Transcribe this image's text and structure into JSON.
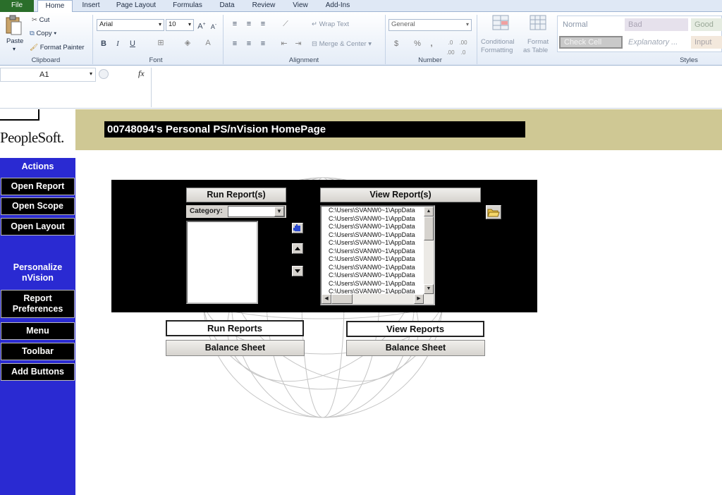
{
  "ribbon": {
    "tabs": [
      "File",
      "Home",
      "Insert",
      "Page Layout",
      "Formulas",
      "Data",
      "Review",
      "View",
      "Add-Ins"
    ],
    "clipboard": {
      "paste": "Paste",
      "cut": "Cut",
      "copy": "Copy",
      "format_painter": "Format Painter",
      "label": "Clipboard"
    },
    "font": {
      "name": "Arial",
      "size": "10",
      "bold": "B",
      "italic": "I",
      "underline": "U",
      "label": "Font"
    },
    "alignment": {
      "wrap_text": "Wrap Text",
      "merge_center": "Merge & Center",
      "label": "Alignment"
    },
    "number": {
      "format": "General",
      "currency": "$",
      "percent": "%",
      "comma": ",",
      "label": "Number"
    },
    "styles": {
      "conditional_formatting": [
        "Conditional",
        "Formatting"
      ],
      "format_as_table": [
        "Format",
        "as Table"
      ],
      "normal": "Normal",
      "bad": "Bad",
      "good": "Good",
      "check_cell": "Check Cell",
      "explanatory": "Explanatory ...",
      "input": "Input",
      "label": "Styles"
    }
  },
  "formula_bar": {
    "name_box": "A1",
    "fx": "fx",
    "formula": ""
  },
  "sheet": {
    "brand": "PeopleSoft.",
    "title": "00748094's Personal PS/nVision HomePage",
    "sidebar": {
      "actions_label": "Actions",
      "actions": [
        "Open Report",
        "Open Scope",
        "Open Layout"
      ],
      "personalize_label": [
        "Personalize",
        "nVision"
      ],
      "personalize": [
        [
          "Report",
          "Preferences"
        ],
        [
          "Menu"
        ],
        [
          "Toolbar"
        ],
        [
          "Add Buttons"
        ]
      ]
    },
    "panel": {
      "run_reports_btn": "Run Report(s)",
      "view_reports_btn": "View Report(s)",
      "category_label": "Category:",
      "category_value": "",
      "report_paths": [
        "C:\\Users\\SVANW0~1\\AppData",
        "C:\\Users\\SVANW0~1\\AppData",
        "C:\\Users\\SVANW0~1\\AppData",
        "C:\\Users\\SVANW0~1\\AppData",
        "C:\\Users\\SVANW0~1\\AppData",
        "C:\\Users\\SVANW0~1\\AppData",
        "C:\\Users\\SVANW0~1\\AppData",
        "C:\\Users\\SVANW0~1\\AppData",
        "C:\\Users\\SVANW0~1\\AppData",
        "C:\\Users\\SVANW0~1\\AppData",
        "C:\\Users\\SVANW0~1\\AppData"
      ]
    },
    "quick_links": {
      "run_reports": "Run Reports",
      "view_reports": "View Reports",
      "run_balance_sheet": "Balance Sheet",
      "view_balance_sheet": "Balance Sheet"
    }
  }
}
